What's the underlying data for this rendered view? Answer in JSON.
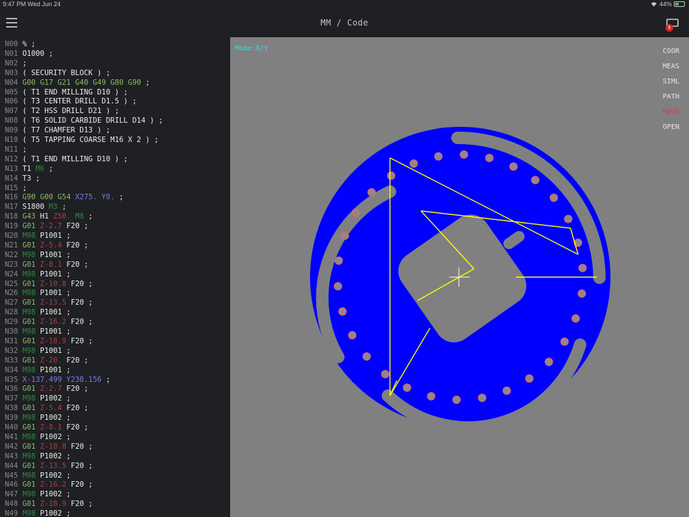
{
  "status": {
    "time": "9:47 PM  Wed Jun 24",
    "battery": "44%"
  },
  "nav": {
    "title": "MM / Code",
    "badge": "5"
  },
  "code": [
    [
      [
        "ln",
        "N00 "
      ],
      [
        "w",
        "% ;"
      ]
    ],
    [
      [
        "ln",
        "N01 "
      ],
      [
        "w",
        "O1000 ;"
      ]
    ],
    [
      [
        "ln",
        "N02 "
      ],
      [
        "w",
        ";"
      ]
    ],
    [
      [
        "ln",
        "N03 "
      ],
      [
        "w",
        "( SECURITY BLOCK ) ;"
      ]
    ],
    [
      [
        "ln",
        "N04 "
      ],
      [
        "g",
        "G00 G17 G21 G40 G49 G80 G90"
      ],
      [
        "w",
        " ;"
      ]
    ],
    [
      [
        "ln",
        "N05 "
      ],
      [
        "w",
        "( T1 END MILLING D10 ) ;"
      ]
    ],
    [
      [
        "ln",
        "N06 "
      ],
      [
        "w",
        "( T3 CENTER DRILL D1.5 ) ;"
      ]
    ],
    [
      [
        "ln",
        "N07 "
      ],
      [
        "w",
        "( T2 HSS DRILL D21 ) ;"
      ]
    ],
    [
      [
        "ln",
        "N08 "
      ],
      [
        "w",
        "( T6 SOLID CARBIDE DRILL D14 ) ;"
      ]
    ],
    [
      [
        "ln",
        "N09 "
      ],
      [
        "w",
        "( T7 CHAMFER D13 ) ;"
      ]
    ],
    [
      [
        "ln",
        "N10 "
      ],
      [
        "w",
        "( T5 TAPPING COARSE M16 X 2 ) ;"
      ]
    ],
    [
      [
        "ln",
        "N11 "
      ],
      [
        "w",
        ";"
      ]
    ],
    [
      [
        "ln",
        "N12 "
      ],
      [
        "w",
        "( T1 END MILLING D10 ) ;"
      ]
    ],
    [
      [
        "ln",
        "N13 "
      ],
      [
        "w",
        "T1 "
      ],
      [
        "dg",
        "M6"
      ],
      [
        "w",
        " ;"
      ]
    ],
    [
      [
        "ln",
        "N14 "
      ],
      [
        "w",
        "T3 ;"
      ]
    ],
    [
      [
        "ln",
        "N15 "
      ],
      [
        "w",
        ";"
      ]
    ],
    [
      [
        "ln",
        "N16 "
      ],
      [
        "g",
        "G90 G00 G54"
      ],
      [
        "w",
        " "
      ],
      [
        "b",
        "X275. Y0."
      ],
      [
        "w",
        " ;"
      ]
    ],
    [
      [
        "ln",
        "N17 "
      ],
      [
        "w",
        "S1800 "
      ],
      [
        "dg",
        "M3"
      ],
      [
        "w",
        " ;"
      ]
    ],
    [
      [
        "ln",
        "N18 "
      ],
      [
        "g",
        "G43"
      ],
      [
        "w",
        " H1 "
      ],
      [
        "r",
        "Z50."
      ],
      [
        "w",
        " "
      ],
      [
        "dg",
        "M8"
      ],
      [
        "w",
        " ;"
      ]
    ],
    [
      [
        "ln",
        "N19 "
      ],
      [
        "g",
        "G01"
      ],
      [
        "w",
        " "
      ],
      [
        "r",
        "Z-2.7"
      ],
      [
        "w",
        " F20 ;"
      ]
    ],
    [
      [
        "ln",
        "N20 "
      ],
      [
        "dg",
        "M98"
      ],
      [
        "w",
        " P1001 ;"
      ]
    ],
    [
      [
        "ln",
        "N21 "
      ],
      [
        "g",
        "G01"
      ],
      [
        "w",
        " "
      ],
      [
        "r",
        "Z-5.4"
      ],
      [
        "w",
        " F20 ;"
      ]
    ],
    [
      [
        "ln",
        "N22 "
      ],
      [
        "dg",
        "M98"
      ],
      [
        "w",
        " P1001 ;"
      ]
    ],
    [
      [
        "ln",
        "N23 "
      ],
      [
        "g",
        "G01"
      ],
      [
        "w",
        " "
      ],
      [
        "r",
        "Z-8.1"
      ],
      [
        "w",
        " F20 ;"
      ]
    ],
    [
      [
        "ln",
        "N24 "
      ],
      [
        "dg",
        "M98"
      ],
      [
        "w",
        " P1001 ;"
      ]
    ],
    [
      [
        "ln",
        "N25 "
      ],
      [
        "g",
        "G01"
      ],
      [
        "w",
        " "
      ],
      [
        "r",
        "Z-10.8"
      ],
      [
        "w",
        " F20 ;"
      ]
    ],
    [
      [
        "ln",
        "N26 "
      ],
      [
        "dg",
        "M98"
      ],
      [
        "w",
        " P1001 ;"
      ]
    ],
    [
      [
        "ln",
        "N27 "
      ],
      [
        "g",
        "G01"
      ],
      [
        "w",
        " "
      ],
      [
        "r",
        "Z-13.5"
      ],
      [
        "w",
        " F20 ;"
      ]
    ],
    [
      [
        "ln",
        "N28 "
      ],
      [
        "dg",
        "M98"
      ],
      [
        "w",
        " P1001 ;"
      ]
    ],
    [
      [
        "ln",
        "N29 "
      ],
      [
        "g",
        "G01"
      ],
      [
        "w",
        " "
      ],
      [
        "r",
        "Z-16.2"
      ],
      [
        "w",
        " F20 ;"
      ]
    ],
    [
      [
        "ln",
        "N30 "
      ],
      [
        "dg",
        "M98"
      ],
      [
        "w",
        " P1001 ;"
      ]
    ],
    [
      [
        "ln",
        "N31 "
      ],
      [
        "g",
        "G01"
      ],
      [
        "w",
        " "
      ],
      [
        "r",
        "Z-18.9"
      ],
      [
        "w",
        " F20 ;"
      ]
    ],
    [
      [
        "ln",
        "N32 "
      ],
      [
        "dg",
        "M98"
      ],
      [
        "w",
        " P1001 ;"
      ]
    ],
    [
      [
        "ln",
        "N33 "
      ],
      [
        "g",
        "G01"
      ],
      [
        "w",
        " "
      ],
      [
        "r",
        "Z-20."
      ],
      [
        "w",
        " F20 ;"
      ]
    ],
    [
      [
        "ln",
        "N34 "
      ],
      [
        "dg",
        "M98"
      ],
      [
        "w",
        " P1001 ;"
      ]
    ],
    [
      [
        "ln",
        "N35 "
      ],
      [
        "b",
        "X-137.499 Y238.156"
      ],
      [
        "w",
        " ;"
      ]
    ],
    [
      [
        "ln",
        "N36 "
      ],
      [
        "g",
        "G01"
      ],
      [
        "w",
        " "
      ],
      [
        "r",
        "Z-2.7"
      ],
      [
        "w",
        " F20 ;"
      ]
    ],
    [
      [
        "ln",
        "N37 "
      ],
      [
        "dg",
        "M98"
      ],
      [
        "w",
        " P1002 ;"
      ]
    ],
    [
      [
        "ln",
        "N38 "
      ],
      [
        "g",
        "G01"
      ],
      [
        "w",
        " "
      ],
      [
        "r",
        "Z-5.4"
      ],
      [
        "w",
        " F20 ;"
      ]
    ],
    [
      [
        "ln",
        "N39 "
      ],
      [
        "dg",
        "M98"
      ],
      [
        "w",
        " P1002 ;"
      ]
    ],
    [
      [
        "ln",
        "N40 "
      ],
      [
        "g",
        "G01"
      ],
      [
        "w",
        " "
      ],
      [
        "r",
        "Z-8.1"
      ],
      [
        "w",
        " F20 ;"
      ]
    ],
    [
      [
        "ln",
        "N41 "
      ],
      [
        "dg",
        "M98"
      ],
      [
        "w",
        " P1002 ;"
      ]
    ],
    [
      [
        "ln",
        "N42 "
      ],
      [
        "g",
        "G01"
      ],
      [
        "w",
        " "
      ],
      [
        "r",
        "Z-10.8"
      ],
      [
        "w",
        " F20 ;"
      ]
    ],
    [
      [
        "ln",
        "N43 "
      ],
      [
        "dg",
        "M98"
      ],
      [
        "w",
        " P1002 ;"
      ]
    ],
    [
      [
        "ln",
        "N44 "
      ],
      [
        "g",
        "G01"
      ],
      [
        "w",
        " "
      ],
      [
        "r",
        "Z-13.5"
      ],
      [
        "w",
        " F20 ;"
      ]
    ],
    [
      [
        "ln",
        "N45 "
      ],
      [
        "dg",
        "M98"
      ],
      [
        "w",
        " P1002 ;"
      ]
    ],
    [
      [
        "ln",
        "N46 "
      ],
      [
        "g",
        "G01"
      ],
      [
        "w",
        " "
      ],
      [
        "r",
        "Z-16.2"
      ],
      [
        "w",
        " F20 ;"
      ]
    ],
    [
      [
        "ln",
        "N47 "
      ],
      [
        "dg",
        "M98"
      ],
      [
        "w",
        " P1002 ;"
      ]
    ],
    [
      [
        "ln",
        "N48 "
      ],
      [
        "g",
        "G01"
      ],
      [
        "w",
        " "
      ],
      [
        "r",
        "Z-18.9"
      ],
      [
        "w",
        " F20 ;"
      ]
    ],
    [
      [
        "ln",
        "N49 "
      ],
      [
        "dg",
        "M98"
      ],
      [
        "w",
        " P1002 ;"
      ]
    ]
  ],
  "view": {
    "mode_label": "Mode:X/Y",
    "menu": [
      "COOR",
      "MEAS",
      "SIML",
      "PATH",
      "MOVE",
      "OPEN"
    ],
    "active_menu": "MOVE",
    "part_color": "#0000ff",
    "toolpath_color": "#ffff00",
    "hole_color": "#ff5a5a",
    "hole_count": 30
  }
}
